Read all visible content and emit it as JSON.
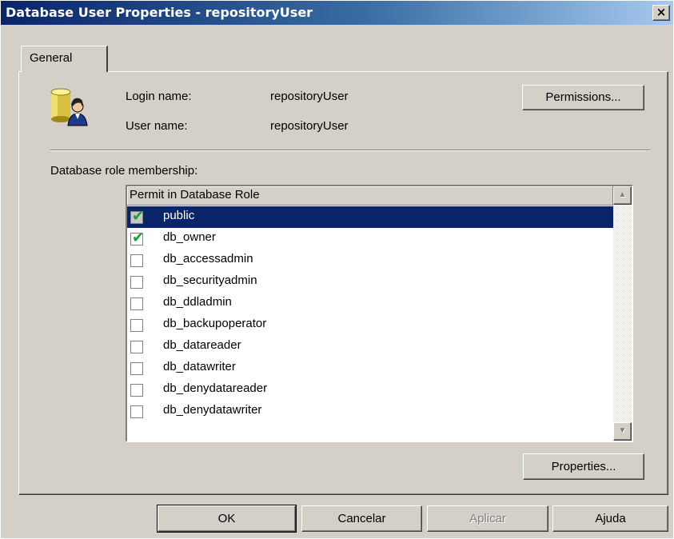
{
  "window": {
    "title": "Database User Properties - repositoryUser",
    "close_glyph": "×"
  },
  "tabs": [
    {
      "label": "General",
      "selected": true
    }
  ],
  "general": {
    "login_label": "Login name:",
    "login_value": "repositoryUser",
    "user_label": "User name:",
    "user_value": "repositoryUser",
    "permissions_button": "Permissions...",
    "role_membership_label": "Database role membership:",
    "properties_button": "Properties..."
  },
  "role_list": {
    "column_header": "Permit in Database Role",
    "rows": [
      {
        "label": "public",
        "checked": true,
        "selected": true
      },
      {
        "label": "db_owner",
        "checked": true,
        "selected": false
      },
      {
        "label": "db_accessadmin",
        "checked": false,
        "selected": false
      },
      {
        "label": "db_securityadmin",
        "checked": false,
        "selected": false
      },
      {
        "label": "db_ddladmin",
        "checked": false,
        "selected": false
      },
      {
        "label": "db_backupoperator",
        "checked": false,
        "selected": false
      },
      {
        "label": "db_datareader",
        "checked": false,
        "selected": false
      },
      {
        "label": "db_datawriter",
        "checked": false,
        "selected": false
      },
      {
        "label": "db_denydatareader",
        "checked": false,
        "selected": false
      },
      {
        "label": "db_denydatawriter",
        "checked": false,
        "selected": false
      }
    ],
    "check_glyph": "✔",
    "up_arrow": "▲",
    "down_arrow": "▼"
  },
  "footer": {
    "ok": "OK",
    "cancel": "Cancelar",
    "apply": "Aplicar",
    "apply_enabled": false,
    "help": "Ajuda"
  },
  "colors": {
    "title_bar_start": "#0a246a",
    "title_bar_end": "#a6caf0",
    "dialog_face": "#d4d0c8",
    "selection": "#0a246a",
    "check": "#17a02c"
  }
}
